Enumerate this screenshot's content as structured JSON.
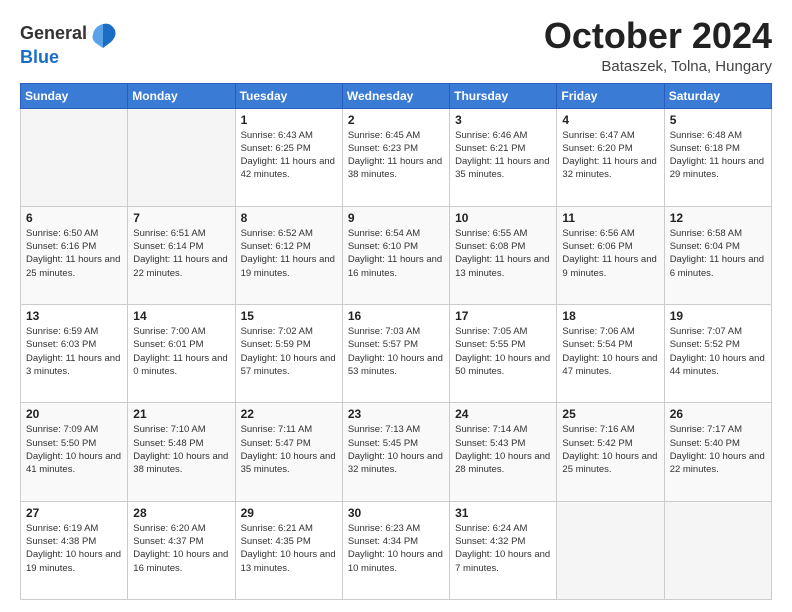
{
  "header": {
    "logo_general": "General",
    "logo_blue": "Blue",
    "month": "October 2024",
    "location": "Bataszek, Tolna, Hungary"
  },
  "days_of_week": [
    "Sunday",
    "Monday",
    "Tuesday",
    "Wednesday",
    "Thursday",
    "Friday",
    "Saturday"
  ],
  "weeks": [
    [
      {
        "day": "",
        "info": ""
      },
      {
        "day": "",
        "info": ""
      },
      {
        "day": "1",
        "info": "Sunrise: 6:43 AM\nSunset: 6:25 PM\nDaylight: 11 hours and 42 minutes."
      },
      {
        "day": "2",
        "info": "Sunrise: 6:45 AM\nSunset: 6:23 PM\nDaylight: 11 hours and 38 minutes."
      },
      {
        "day": "3",
        "info": "Sunrise: 6:46 AM\nSunset: 6:21 PM\nDaylight: 11 hours and 35 minutes."
      },
      {
        "day": "4",
        "info": "Sunrise: 6:47 AM\nSunset: 6:20 PM\nDaylight: 11 hours and 32 minutes."
      },
      {
        "day": "5",
        "info": "Sunrise: 6:48 AM\nSunset: 6:18 PM\nDaylight: 11 hours and 29 minutes."
      }
    ],
    [
      {
        "day": "6",
        "info": "Sunrise: 6:50 AM\nSunset: 6:16 PM\nDaylight: 11 hours and 25 minutes."
      },
      {
        "day": "7",
        "info": "Sunrise: 6:51 AM\nSunset: 6:14 PM\nDaylight: 11 hours and 22 minutes."
      },
      {
        "day": "8",
        "info": "Sunrise: 6:52 AM\nSunset: 6:12 PM\nDaylight: 11 hours and 19 minutes."
      },
      {
        "day": "9",
        "info": "Sunrise: 6:54 AM\nSunset: 6:10 PM\nDaylight: 11 hours and 16 minutes."
      },
      {
        "day": "10",
        "info": "Sunrise: 6:55 AM\nSunset: 6:08 PM\nDaylight: 11 hours and 13 minutes."
      },
      {
        "day": "11",
        "info": "Sunrise: 6:56 AM\nSunset: 6:06 PM\nDaylight: 11 hours and 9 minutes."
      },
      {
        "day": "12",
        "info": "Sunrise: 6:58 AM\nSunset: 6:04 PM\nDaylight: 11 hours and 6 minutes."
      }
    ],
    [
      {
        "day": "13",
        "info": "Sunrise: 6:59 AM\nSunset: 6:03 PM\nDaylight: 11 hours and 3 minutes."
      },
      {
        "day": "14",
        "info": "Sunrise: 7:00 AM\nSunset: 6:01 PM\nDaylight: 11 hours and 0 minutes."
      },
      {
        "day": "15",
        "info": "Sunrise: 7:02 AM\nSunset: 5:59 PM\nDaylight: 10 hours and 57 minutes."
      },
      {
        "day": "16",
        "info": "Sunrise: 7:03 AM\nSunset: 5:57 PM\nDaylight: 10 hours and 53 minutes."
      },
      {
        "day": "17",
        "info": "Sunrise: 7:05 AM\nSunset: 5:55 PM\nDaylight: 10 hours and 50 minutes."
      },
      {
        "day": "18",
        "info": "Sunrise: 7:06 AM\nSunset: 5:54 PM\nDaylight: 10 hours and 47 minutes."
      },
      {
        "day": "19",
        "info": "Sunrise: 7:07 AM\nSunset: 5:52 PM\nDaylight: 10 hours and 44 minutes."
      }
    ],
    [
      {
        "day": "20",
        "info": "Sunrise: 7:09 AM\nSunset: 5:50 PM\nDaylight: 10 hours and 41 minutes."
      },
      {
        "day": "21",
        "info": "Sunrise: 7:10 AM\nSunset: 5:48 PM\nDaylight: 10 hours and 38 minutes."
      },
      {
        "day": "22",
        "info": "Sunrise: 7:11 AM\nSunset: 5:47 PM\nDaylight: 10 hours and 35 minutes."
      },
      {
        "day": "23",
        "info": "Sunrise: 7:13 AM\nSunset: 5:45 PM\nDaylight: 10 hours and 32 minutes."
      },
      {
        "day": "24",
        "info": "Sunrise: 7:14 AM\nSunset: 5:43 PM\nDaylight: 10 hours and 28 minutes."
      },
      {
        "day": "25",
        "info": "Sunrise: 7:16 AM\nSunset: 5:42 PM\nDaylight: 10 hours and 25 minutes."
      },
      {
        "day": "26",
        "info": "Sunrise: 7:17 AM\nSunset: 5:40 PM\nDaylight: 10 hours and 22 minutes."
      }
    ],
    [
      {
        "day": "27",
        "info": "Sunrise: 6:19 AM\nSunset: 4:38 PM\nDaylight: 10 hours and 19 minutes."
      },
      {
        "day": "28",
        "info": "Sunrise: 6:20 AM\nSunset: 4:37 PM\nDaylight: 10 hours and 16 minutes."
      },
      {
        "day": "29",
        "info": "Sunrise: 6:21 AM\nSunset: 4:35 PM\nDaylight: 10 hours and 13 minutes."
      },
      {
        "day": "30",
        "info": "Sunrise: 6:23 AM\nSunset: 4:34 PM\nDaylight: 10 hours and 10 minutes."
      },
      {
        "day": "31",
        "info": "Sunrise: 6:24 AM\nSunset: 4:32 PM\nDaylight: 10 hours and 7 minutes."
      },
      {
        "day": "",
        "info": ""
      },
      {
        "day": "",
        "info": ""
      }
    ]
  ]
}
